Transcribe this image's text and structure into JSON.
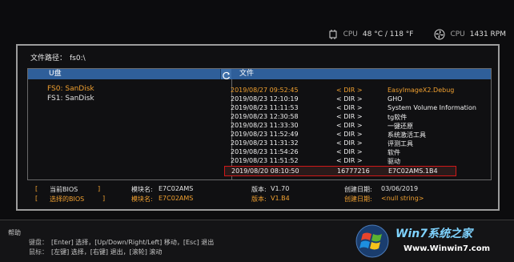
{
  "status": {
    "cpu_temp_label": "CPU",
    "cpu_temp": "48 °C / 118 °F",
    "cpu_fan_label": "CPU",
    "cpu_fan": "1431 RPM"
  },
  "panel": {
    "path_label": "文件路径：",
    "path_value": "fs0:\\",
    "disk_header": "U盘",
    "file_header": "文件",
    "disks": [
      "FS0: SanDisk",
      "FS1: SanDisk"
    ],
    "files": [
      {
        "date": "2019/08/27 09:52:45",
        "size": "< DIR >",
        "name": "EasyImageX2.Debug"
      },
      {
        "date": "2019/08/23 12:10:19",
        "size": "< DIR >",
        "name": "GHO"
      },
      {
        "date": "2019/08/23 11:11:53",
        "size": "< DIR >",
        "name": "System Volume Information"
      },
      {
        "date": "2019/08/23 12:30:58",
        "size": "< DIR >",
        "name": "tg软件"
      },
      {
        "date": "2019/08/23 11:33:30",
        "size": "< DIR >",
        "name": "一键还原"
      },
      {
        "date": "2019/08/23 11:52:49",
        "size": "< DIR >",
        "name": "系统激活工具"
      },
      {
        "date": "2019/08/23 11:31:32",
        "size": "< DIR >",
        "name": "评测工具"
      },
      {
        "date": "2019/08/23 11:54:26",
        "size": "< DIR >",
        "name": "软件"
      },
      {
        "date": "2019/08/23 11:51:52",
        "size": "< DIR >",
        "name": "驱动"
      },
      {
        "date": "2019/08/20 08:10:50",
        "size": "16777216",
        "name": "E7C02AMS.1B4"
      }
    ],
    "bios_current_label": "当前BIOS",
    "bios_selected_label": "选择的BIOS",
    "current": {
      "model_label": "模块名:",
      "model": "E7C02AMS",
      "version_label": "版本:",
      "version": "V1.70",
      "date_label": "创建日期:",
      "date": "03/06/2019"
    },
    "selected": {
      "model_label": "模块名:",
      "model": "E7C02AMS",
      "version_label": "版本:",
      "version": "V1.B4",
      "date_label": "创建日期:",
      "date": "<null string>"
    }
  },
  "help": {
    "title": "帮助",
    "keyboard_label": "键盘：",
    "keyboard": "[Enter] 选择，[Up/Down/Right/Left] 移动，[Esc] 退出",
    "mouse_label": "鼠标：",
    "mouse": "[左键] 选择，[右键] 退出，[滚轮] 滚动"
  },
  "watermark": {
    "brand": "Win7系统之家",
    "url": "Www.Winwin7.com"
  },
  "colors": {
    "accent": "#f0a030",
    "header": "#2f5f9a",
    "selection_border": "#d01818"
  }
}
